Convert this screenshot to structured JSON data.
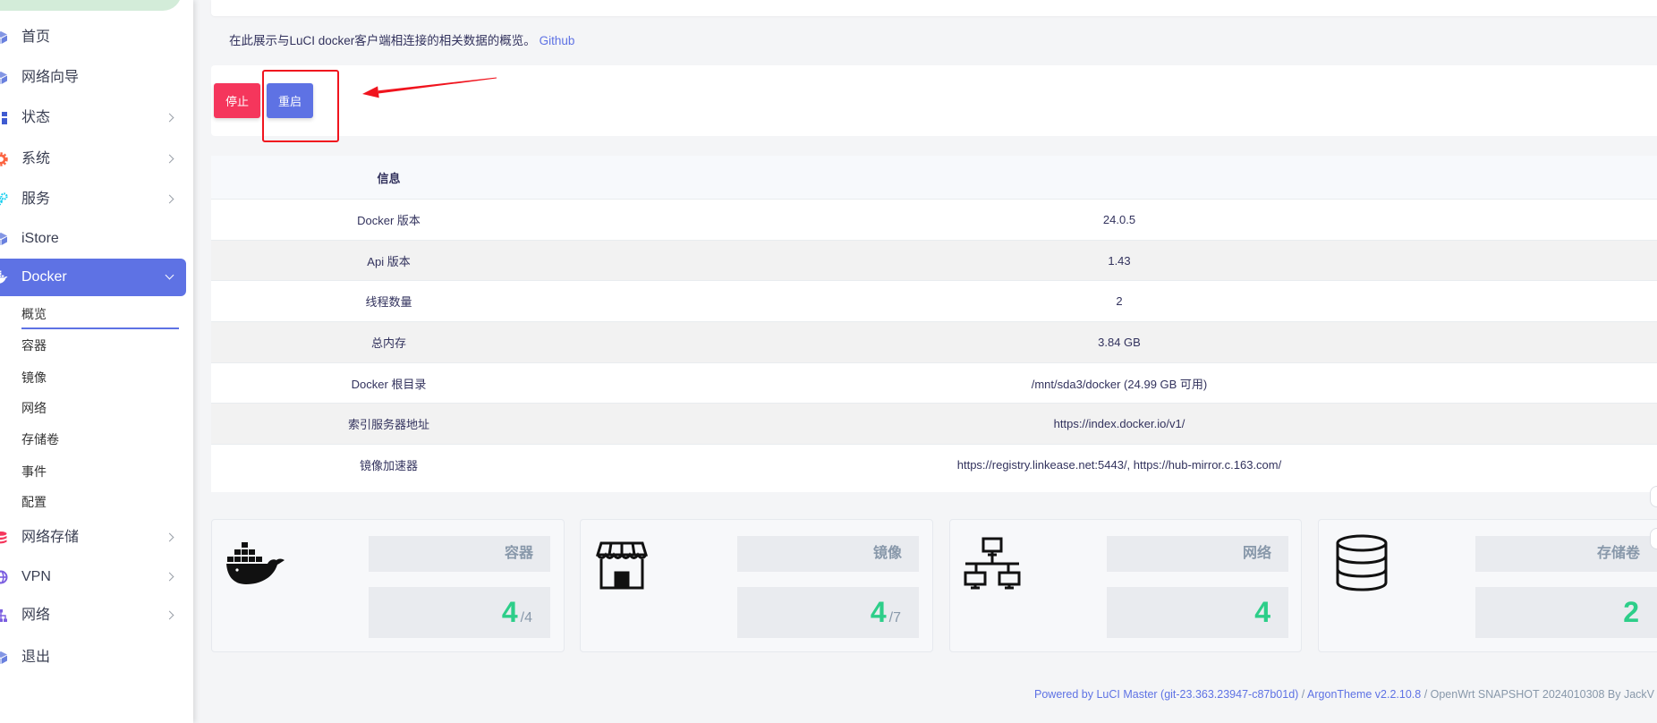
{
  "theme": {
    "primary": "#5e72e4",
    "danger": "#f5365c",
    "success": "#2dce89",
    "muted": "#8898aa",
    "annotation": "#f0141e"
  },
  "sidebar": {
    "menu": [
      {
        "label": "首页",
        "icon": "cube-icon",
        "icon_color": "#4f6ad8"
      },
      {
        "label": "网络向导",
        "icon": "cube-icon",
        "icon_color": "#4f6ad8"
      },
      {
        "label": "状态",
        "icon": "dashboard-grid-icon",
        "icon_color": "#3f5bd1"
      },
      {
        "label": "系统",
        "icon": "gear-icon",
        "icon_color": "#fb6340"
      },
      {
        "label": "服务",
        "icon": "cogs-icon",
        "icon_color": "#11cdef"
      },
      {
        "label": "iStore",
        "icon": "cube-icon",
        "icon_color": "#4f6ad8"
      },
      {
        "label": "Docker",
        "icon": "docker-whale-icon",
        "icon_color": "#ffffff"
      },
      {
        "label": "网络存储",
        "icon": "storage-stack-icon",
        "icon_color": "#f5365c"
      },
      {
        "label": "VPN",
        "icon": "globe-icon",
        "icon_color": "#7b5ee0"
      },
      {
        "label": "网络",
        "icon": "sitemap-icon",
        "icon_color": "#7b5ee0"
      },
      {
        "label": "退出",
        "icon": "cube-icon",
        "icon_color": "#4f6ad8"
      }
    ],
    "submenu": [
      {
        "label": "概览"
      },
      {
        "label": "容器"
      },
      {
        "label": "镜像"
      },
      {
        "label": "网络"
      },
      {
        "label": "存储卷"
      },
      {
        "label": "事件"
      },
      {
        "label": "配置"
      }
    ]
  },
  "main": {
    "description": "在此展示与LuCI docker客户端相连接的相关数据的概览。",
    "github_link": "Github",
    "buttons": {
      "stop": "停止",
      "restart": "重启"
    },
    "info_table": {
      "header": "信息",
      "rows": [
        {
          "label": "Docker 版本",
          "value": "24.0.5"
        },
        {
          "label": "Api 版本",
          "value": "1.43"
        },
        {
          "label": "线程数量",
          "value": "2"
        },
        {
          "label": "总内存",
          "value": "3.84 GB"
        },
        {
          "label": "Docker 根目录",
          "value": "/mnt/sda3/docker (24.99 GB 可用)"
        },
        {
          "label": "索引服务器地址",
          "value": "https://index.docker.io/v1/"
        },
        {
          "label": "镜像加速器",
          "value": "https://registry.linkease.net:5443/, https://hub-mirror.c.163.com/"
        }
      ]
    },
    "stats": [
      {
        "label": "容器",
        "value": "4",
        "total": "/4",
        "icon": "docker-whale-icon"
      },
      {
        "label": "镜像",
        "value": "4",
        "total": "/7",
        "icon": "store-icon"
      },
      {
        "label": "网络",
        "value": "4",
        "icon": "network-icon"
      },
      {
        "label": "存储卷",
        "value": "2",
        "icon": "database-icon"
      }
    ]
  },
  "footer": {
    "luci": "Powered by LuCI Master (git-23.363.23947-c87b01d)",
    "sep": " / ",
    "theme": "ArgonTheme v2.2.10.8",
    "openwrt": " / OpenWrt SNAPSHOT 2024010308 By JackV"
  }
}
